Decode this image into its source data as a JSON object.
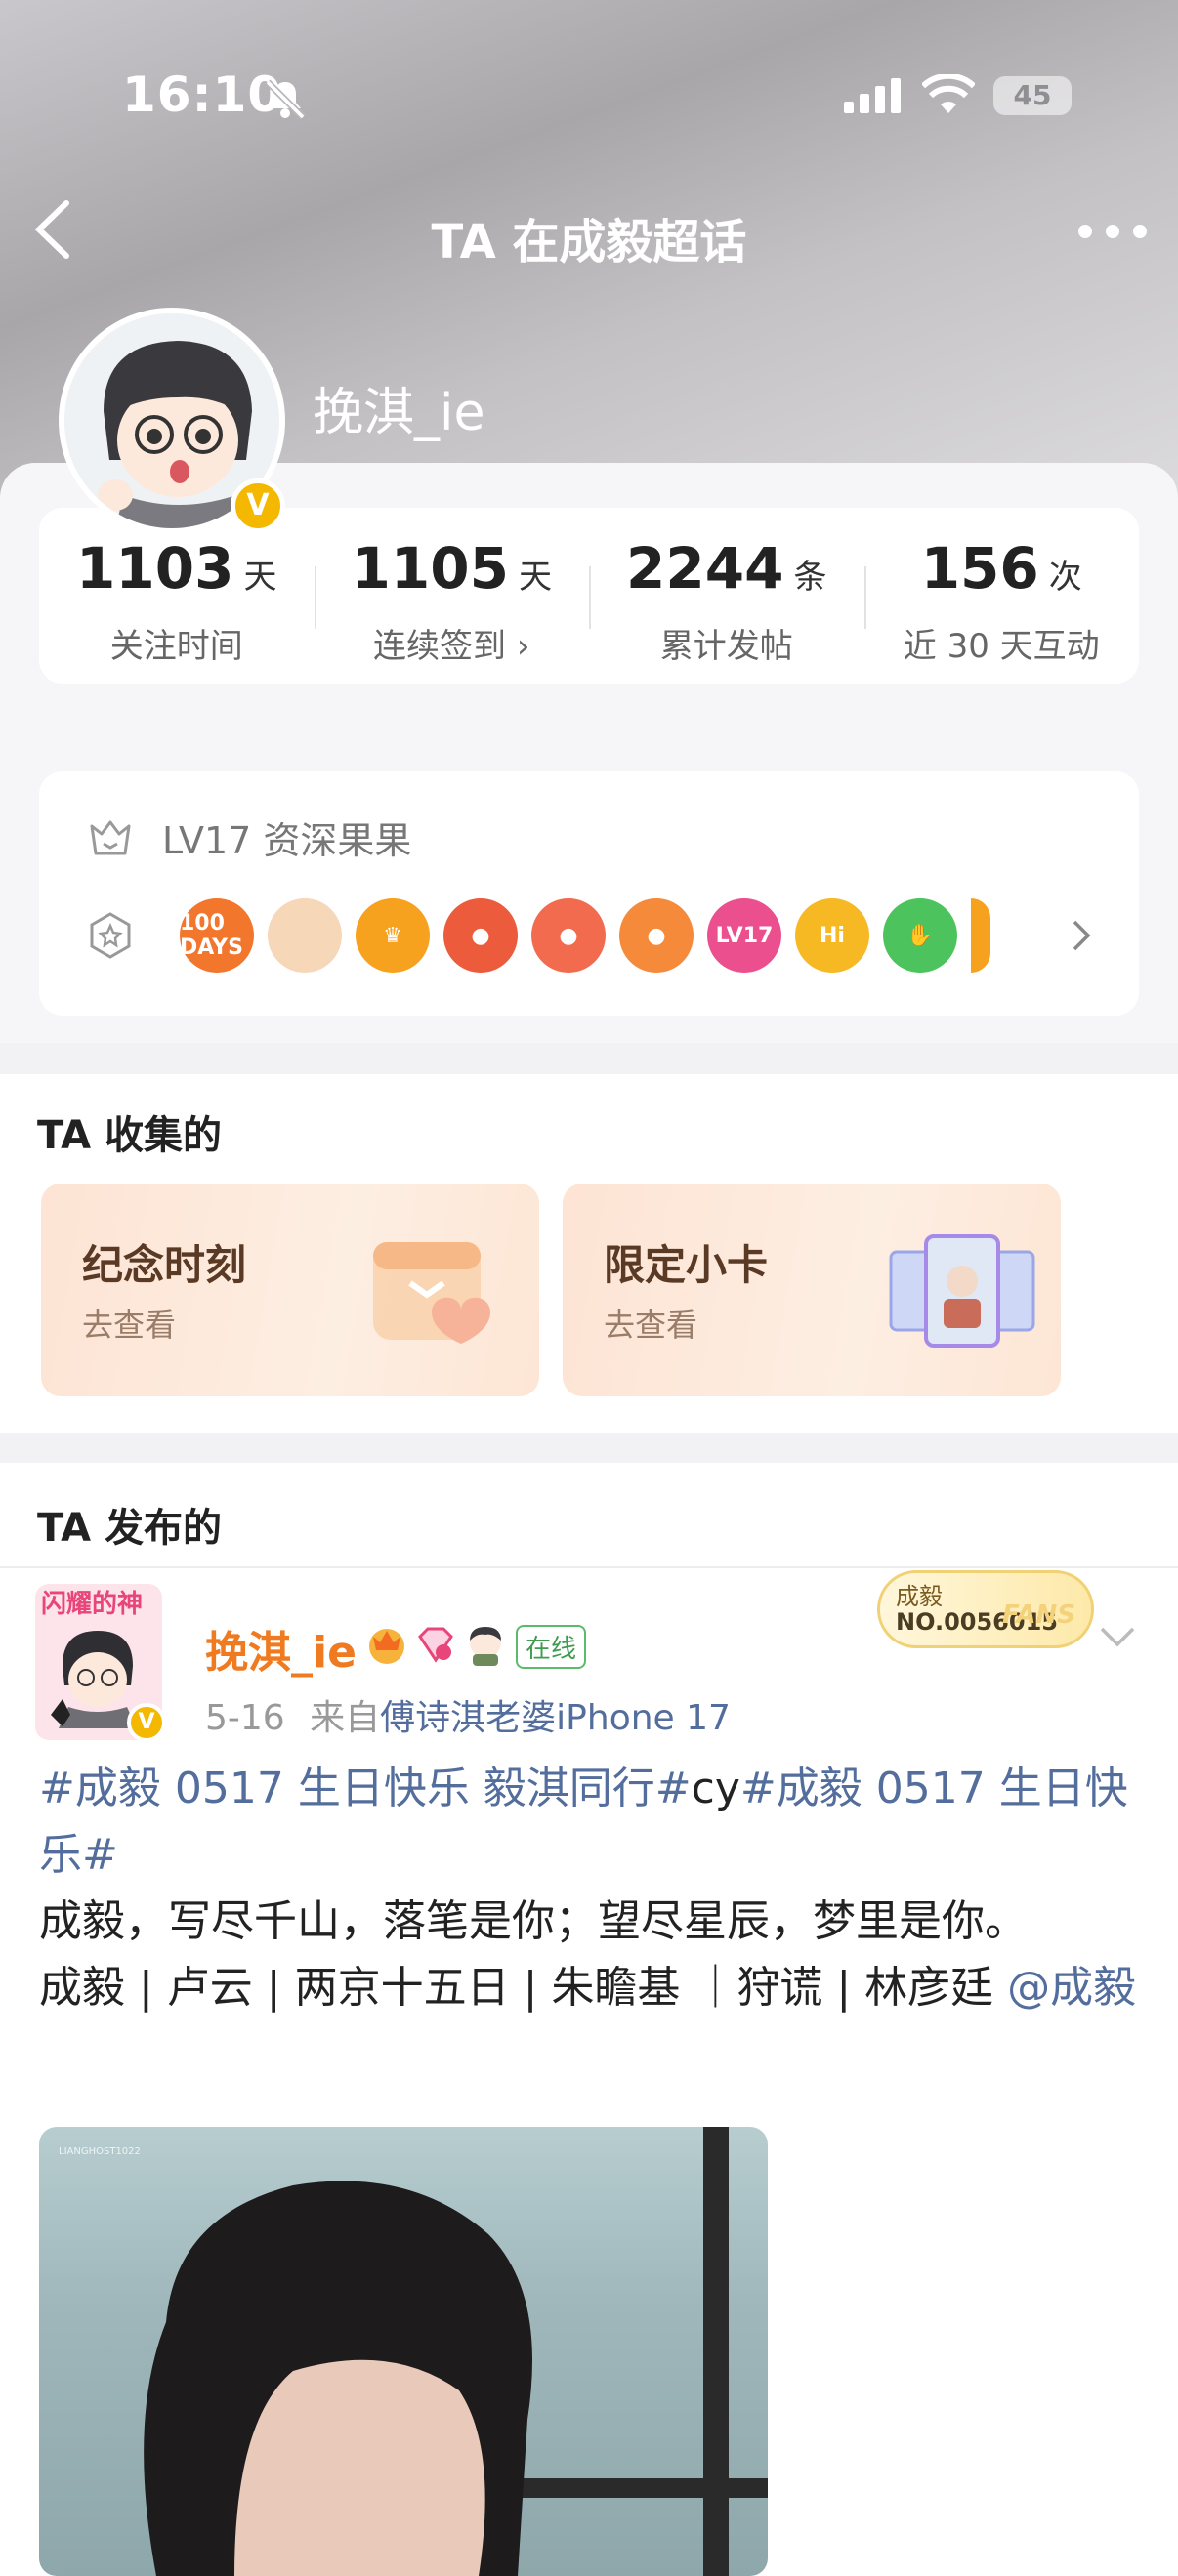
{
  "status_bar": {
    "time": "16:10",
    "battery": "45"
  },
  "nav": {
    "title": "TA 在成毅超话"
  },
  "profile": {
    "username": "挽淇_ie",
    "verified_mark": "V"
  },
  "stats": [
    {
      "value": "1103",
      "unit": "天",
      "label": "关注时间"
    },
    {
      "value": "1105",
      "unit": "天",
      "label": "连续签到 ›"
    },
    {
      "value": "2244",
      "unit": "条",
      "label": "累计发帖"
    },
    {
      "value": "156",
      "unit": "次",
      "label": "近 30 天互动"
    }
  ],
  "level": {
    "text": "LV17 资深果果"
  },
  "badges": [
    "100 DAYS",
    "avatar-badge",
    "crown-badge",
    "fox-badge",
    "girl-badge",
    "rabbit-badge",
    "LV17",
    "Hi",
    "hand-badge",
    "partial-badge"
  ],
  "collected": {
    "title": "TA 收集的",
    "cards": [
      {
        "title": "纪念时刻",
        "sub": "去查看"
      },
      {
        "title": "限定小卡",
        "sub": "去查看"
      }
    ]
  },
  "published": {
    "title": "TA 发布的"
  },
  "post": {
    "username": "挽淇_ie",
    "online": "在线",
    "date": "5-16",
    "from_prefix": "来自",
    "device": "傅诗淇老婆iPhone 17",
    "fans_badge": {
      "line1": "成毅",
      "line2": "NO.0056015",
      "mark": "FANS"
    },
    "avatar_text": "闪耀的神",
    "text_tags": "#成毅 0517 生日快乐 毅淇同行#",
    "text_mid": "cy",
    "text_tags2": "#成毅 0517 生日快乐#",
    "line2": "成毅，写尽千山，落笔是你；望尽星辰，梦里是你。",
    "line3": "成毅 | 卢云 | 两京十五日 | 朱瞻基 ｜狩谎 | 林彦廷 ",
    "mention": "@成毅",
    "image_watermark": "LIANGHOST1022"
  }
}
